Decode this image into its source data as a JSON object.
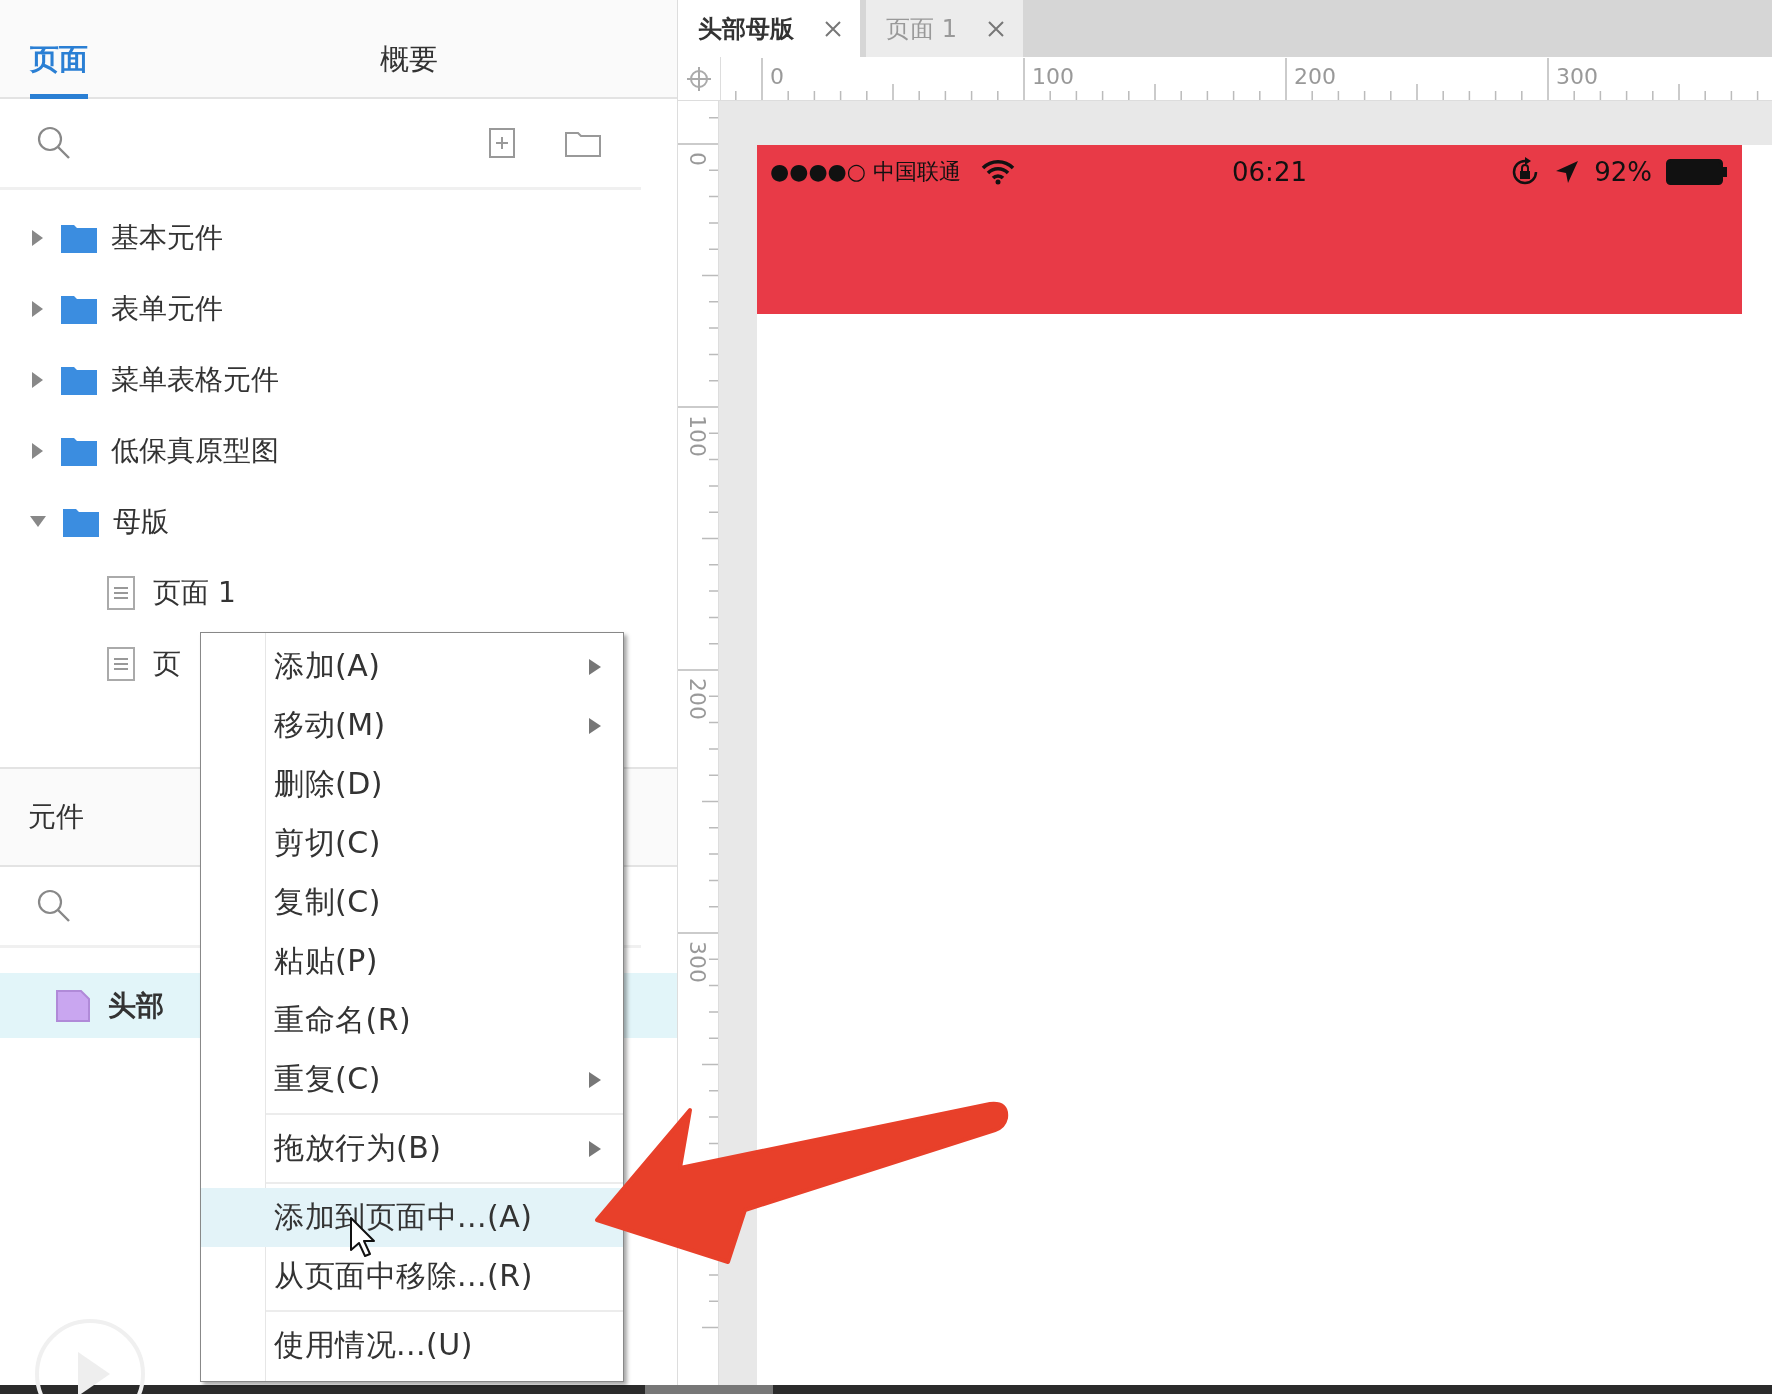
{
  "left_panel": {
    "tabs": [
      {
        "label": "页面",
        "selected": true
      },
      {
        "label": "概要",
        "selected": false
      }
    ],
    "page_tree": [
      {
        "label": "基本元件",
        "kind": "folder",
        "expanded": false
      },
      {
        "label": "表单元件",
        "kind": "folder",
        "expanded": false
      },
      {
        "label": "菜单表格元件",
        "kind": "folder",
        "expanded": false
      },
      {
        "label": "低保真原型图",
        "kind": "folder",
        "expanded": false
      },
      {
        "label": "母版",
        "kind": "folder",
        "expanded": true,
        "children": [
          {
            "label": "页面 1",
            "kind": "page"
          },
          {
            "label": "页",
            "kind": "page"
          }
        ]
      }
    ],
    "masters_section": {
      "title": "元件",
      "items": [
        {
          "label": "头部",
          "selected": true
        }
      ]
    }
  },
  "context_menu": {
    "items": [
      {
        "kind": "item",
        "label": "添加(A)",
        "submenu": true,
        "selected": false
      },
      {
        "kind": "item",
        "label": "移动(M)",
        "submenu": true,
        "selected": false
      },
      {
        "kind": "item",
        "label": "删除(D)",
        "submenu": false,
        "selected": false
      },
      {
        "kind": "item",
        "label": "剪切(C)",
        "submenu": false,
        "selected": false
      },
      {
        "kind": "item",
        "label": "复制(C)",
        "submenu": false,
        "selected": false
      },
      {
        "kind": "item",
        "label": "粘贴(P)",
        "submenu": false,
        "selected": false
      },
      {
        "kind": "item",
        "label": "重命名(R)",
        "submenu": false,
        "selected": false
      },
      {
        "kind": "item",
        "label": "重复(C)",
        "submenu": true,
        "selected": false
      },
      {
        "kind": "separator"
      },
      {
        "kind": "item",
        "label": "拖放行为(B)",
        "submenu": true,
        "selected": false
      },
      {
        "kind": "separator"
      },
      {
        "kind": "item",
        "label": "添加到页面中...(A)",
        "submenu": false,
        "selected": true
      },
      {
        "kind": "item",
        "label": "从页面中移除...(R)",
        "submenu": false,
        "selected": false
      },
      {
        "kind": "separator"
      },
      {
        "kind": "item",
        "label": "使用情况...(U)",
        "submenu": false,
        "selected": false
      }
    ]
  },
  "canvas": {
    "tabs": [
      {
        "label": "头部母版",
        "selected": true
      },
      {
        "label": "页面 1",
        "selected": false
      }
    ],
    "ruler": {
      "x_labels": [
        "0",
        "100",
        "200",
        "300"
      ],
      "y_labels": [
        "0",
        "100",
        "200",
        "300"
      ]
    },
    "status_bar": {
      "carrier": "●●●●○ 中国联通",
      "time": "06:21",
      "battery": "92%"
    }
  }
}
